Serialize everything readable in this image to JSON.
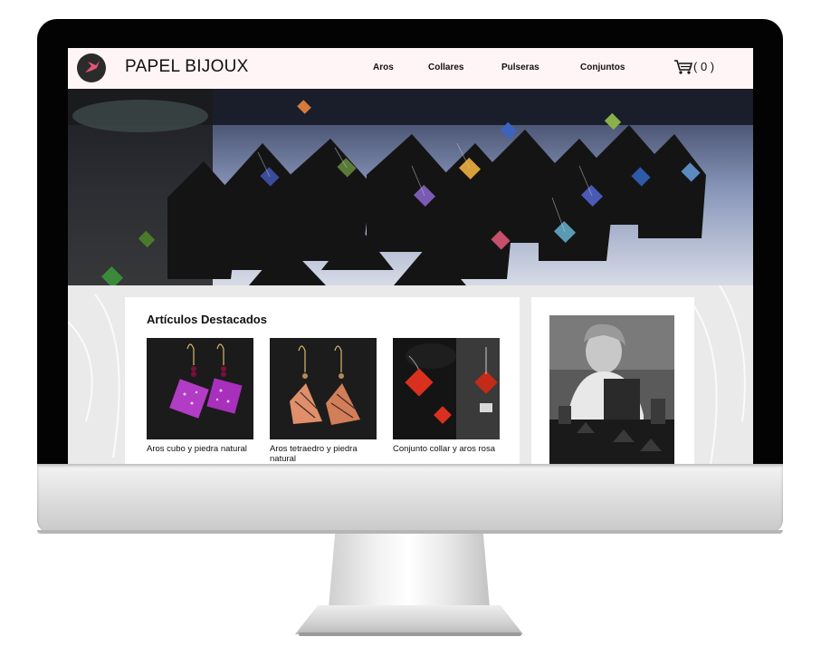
{
  "site": {
    "brand": "PAPEL BIJOUX",
    "logo_icon": "hummingbird-icon",
    "logo_color": "#e3557a"
  },
  "nav": {
    "links": [
      "Aros",
      "Collares",
      "Pulseras",
      "Conjuntos"
    ],
    "cart_icon": "shopping-cart-icon",
    "cart_count": "( 0 )"
  },
  "featured": {
    "title": "Artículos Destacados",
    "products": [
      {
        "name": "Aros cubo y piedra natural",
        "color": "#b33cc6"
      },
      {
        "name": "Aros tetraedro y piedra natural",
        "color": "#e08f6a"
      },
      {
        "name": "Conjunto collar y aros rosa",
        "color": "#d9311e"
      }
    ]
  },
  "colors": {
    "navbar_bg": "#fff5f6",
    "bezel": "#030303"
  }
}
